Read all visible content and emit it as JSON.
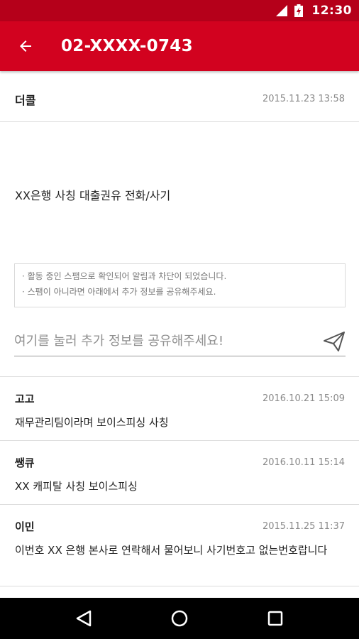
{
  "status_bar": {
    "time": "12:30"
  },
  "app_bar": {
    "title": "02-XXXX-0743",
    "background_color": "#d2021f"
  },
  "post": {
    "author": "더콜",
    "date": "2015.11.23 13:58",
    "body": "XX은행 사칭 대출권유 전화/사기"
  },
  "notice": {
    "lines": [
      "· 활동 중인 스팸으로 확인되어 알림과 차단이 되었습니다.",
      "· 스팸이 아니라면 아래에서 추가 정보를 공유해주세요."
    ]
  },
  "share": {
    "placeholder": "여기를 눌러 추가 정보를 공유해주세요!"
  },
  "comments": [
    {
      "author": "고고",
      "date": "2016.10.21 15:09",
      "text": "재무관리팀이라며 보이스피싱 사칭"
    },
    {
      "author": "쌩큐",
      "date": "2016.10.11 15:14",
      "text": " XX 캐피탈 사칭 보이스피싱"
    },
    {
      "author": "이민",
      "date": "2015.11.25 11:37",
      "text": "이번호  XX 은행 본사로 연락해서 물어보니 사기번호고 없는번호랍니다"
    }
  ]
}
